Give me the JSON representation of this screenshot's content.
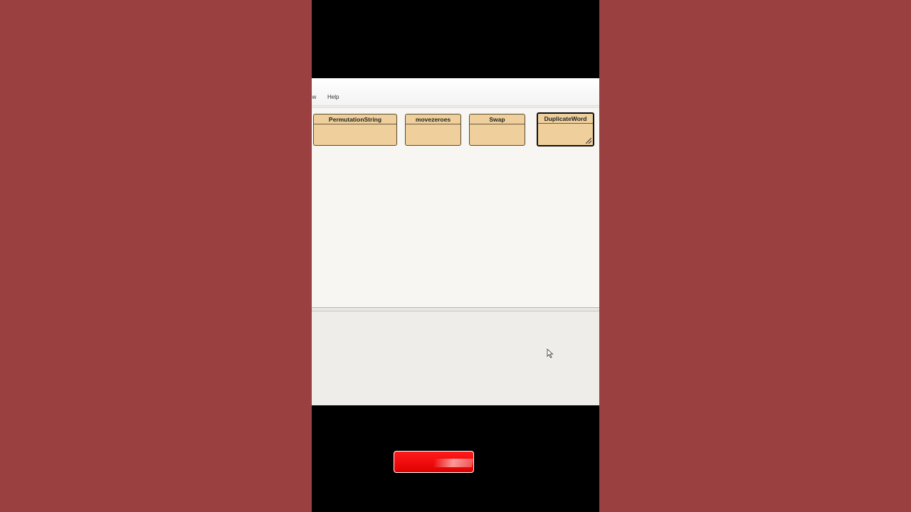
{
  "menu": {
    "items": [
      {
        "label": "ew"
      },
      {
        "label": "Help"
      }
    ]
  },
  "diagram": {
    "classes": [
      {
        "name": "PermutationString",
        "selected": false
      },
      {
        "name": "movezeroes",
        "selected": false
      },
      {
        "name": "Swap",
        "selected": false
      },
      {
        "name": "DuplicateWord",
        "selected": true
      }
    ]
  },
  "colors": {
    "background": "#9a4040",
    "class_fill": "#efcf9b",
    "button_red": "#ff0000"
  },
  "icons": {
    "cursor": "mouse-pointer-icon",
    "resize": "resize-handle-icon"
  }
}
